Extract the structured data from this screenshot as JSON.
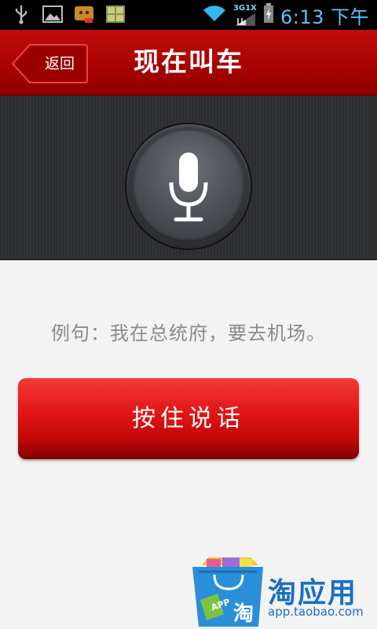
{
  "status_bar": {
    "network": "3G1X",
    "time": "6:13 下午"
  },
  "header": {
    "back_label": "返回",
    "title": "现在叫车"
  },
  "mic_panel": {
    "icon": "microphone-icon"
  },
  "main": {
    "example_text": "例句：我在总统府，要去机场。",
    "talk_button_label": "按住说话"
  },
  "watermark": {
    "brand": "淘应用",
    "url": "app.taobao.com",
    "bag_label": "淘",
    "tag_label": "APP"
  },
  "colors": {
    "header_red": "#a80303",
    "button_red": "#e01414",
    "clock_blue": "#58c6f6",
    "brand_blue": "#1a6fc4"
  }
}
